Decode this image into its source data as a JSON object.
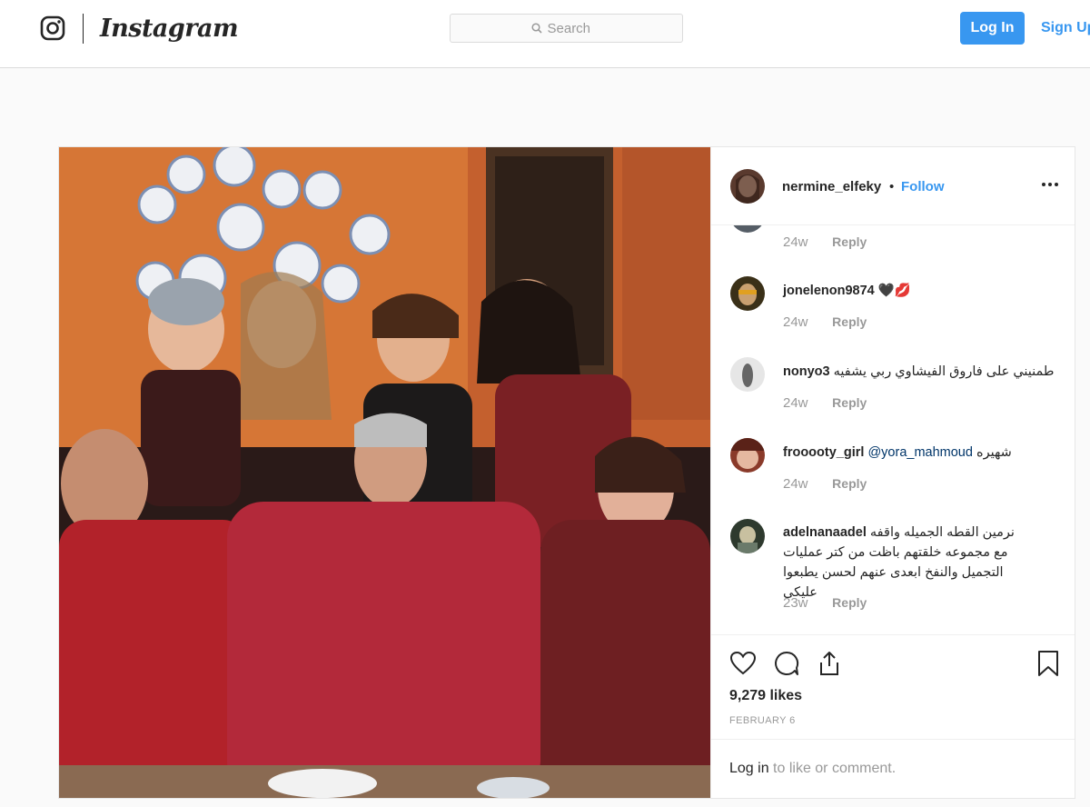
{
  "nav": {
    "logo_icon": "instagram-glyph-icon",
    "wordmark": "Instagram",
    "search_placeholder": "Search",
    "search_icon": "search-icon",
    "login_label": "Log In",
    "signup_label": "Sign Up"
  },
  "post": {
    "photo": "group-photo",
    "author": {
      "username": "nermine_elfeky",
      "separator": "•",
      "follow_label": "Follow",
      "more_icon": "more-options-icon"
    },
    "comments": [
      {
        "username": "",
        "text": "",
        "time": "24w",
        "reply_label": "Reply"
      },
      {
        "username": "jonelenon9874",
        "text": "🖤💋",
        "time": "24w",
        "reply_label": "Reply"
      },
      {
        "username": "nonyo3",
        "text": "طمنيني على فاروق الفيشاوي ربي يشفيه",
        "time": "24w",
        "reply_label": "Reply"
      },
      {
        "username": "frooooty_girl",
        "mention": "@yora_mahmoud",
        "text": "شهيره",
        "time": "24w",
        "reply_label": "Reply"
      },
      {
        "username": "adelnanaadel",
        "text": "نرمين القطه الجميله واقفه مع مجموعه خلقتهم باظت من كتر عمليات التجميل والنفخ ابعدى عنهم لحسن يطبعوا عليكى",
        "time": "23w",
        "reply_label": "Reply"
      }
    ],
    "actions": {
      "like_icon": "heart-icon",
      "comment_icon": "comment-icon",
      "share_icon": "share-icon",
      "save_icon": "bookmark-icon"
    },
    "likes": "9,279 likes",
    "date": "FEBRUARY 6",
    "login_prompt": {
      "link": "Log in",
      "text": " to like or comment."
    }
  },
  "colors": {
    "accent": "#3897f0",
    "border": "#dbdbdb",
    "muted": "#999999",
    "text": "#262626"
  }
}
